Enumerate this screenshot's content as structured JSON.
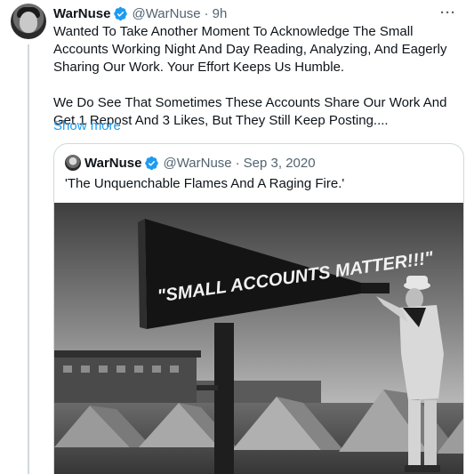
{
  "tweet": {
    "author_name": "WarNuse",
    "author_handle": "@WarNuse",
    "separator": "·",
    "time": "9h",
    "more": "···",
    "paragraph1": "Wanted To Take Another Moment To Acknowledge The Small Accounts Working Night And Day Reading, Analyzing, And Eagerly Sharing Our Work. Your Effort Keeps Us Humble.",
    "paragraph2": "We Do See That Sometimes These Accounts Share Our Work And Get 1 Repost And 3 Likes, But They Still Keep Posting....",
    "show_more": "Show more"
  },
  "quoted": {
    "author_name": "WarNuse",
    "author_handle": "@WarNuse",
    "separator": "·",
    "date": "Sep 3, 2020",
    "text": "'The Unquenchable Flames And A Raging Fire.'",
    "image_caption": "\"SMALL ACCOUNTS MATTER!!!\""
  },
  "colors": {
    "accent": "#1d9bf0",
    "text": "#0f1419",
    "muted": "#536471",
    "border": "#cfd9de"
  },
  "icons": [
    "verified-badge-icon",
    "more-options-icon"
  ]
}
